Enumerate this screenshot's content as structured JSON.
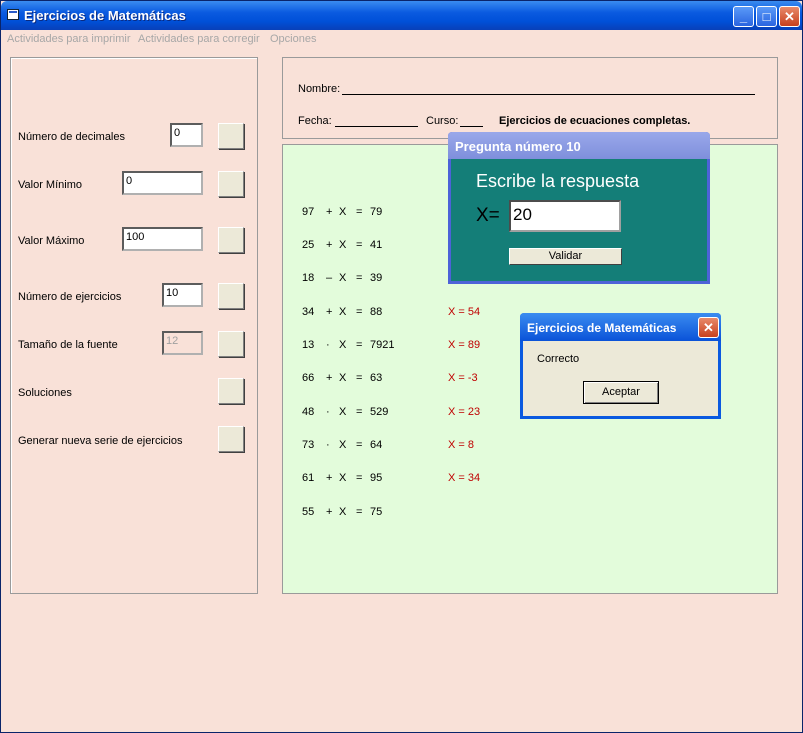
{
  "window": {
    "title": "Ejercicios de Matemáticas"
  },
  "menu": [
    "Actividades para imprimir",
    "Actividades para corregir",
    "Opciones"
  ],
  "settings": {
    "decimales": {
      "label": "Número de decimales",
      "value": "0"
    },
    "minimo": {
      "label": "Valor Mínimo",
      "value": "0"
    },
    "maximo": {
      "label": "Valor Máximo",
      "value": "100"
    },
    "ejercicios": {
      "label": "Número de ejercicios",
      "value": "10"
    },
    "fuente": {
      "label": "Tamaño de la fuente",
      "value": "12"
    },
    "soluciones": {
      "label": "Soluciones"
    },
    "generar": {
      "label": "Generar nueva serie de ejercicios"
    }
  },
  "header": {
    "nombre": "Nombre:",
    "fecha": "Fecha:",
    "curso": "Curso:",
    "title": "Ejercicios de ecuaciones completas."
  },
  "exercises": [
    {
      "a": "97",
      "op": "+",
      "x": "X",
      "eq": "=",
      "result": "79",
      "solution": ""
    },
    {
      "a": "25",
      "op": "+",
      "x": "X",
      "eq": "=",
      "result": "41",
      "solution": ""
    },
    {
      "a": "18",
      "op": "–",
      "x": "X",
      "eq": "=",
      "result": "39",
      "solution": ""
    },
    {
      "a": "34",
      "op": "+",
      "x": "X",
      "eq": "=",
      "result": "88",
      "solution": "X = 54"
    },
    {
      "a": "13",
      "op": "·",
      "x": "X",
      "eq": "=",
      "result": "7921",
      "solution": "X = 89"
    },
    {
      "a": "66",
      "op": "+",
      "x": "X",
      "eq": "=",
      "result": "63",
      "solution": "X = -3"
    },
    {
      "a": "48",
      "op": "·",
      "x": "X",
      "eq": "=",
      "result": "529",
      "solution": "X = 23"
    },
    {
      "a": "73",
      "op": "·",
      "x": "X",
      "eq": "=",
      "result": "64",
      "solution": "X = 8"
    },
    {
      "a": "61",
      "op": "+",
      "x": "X",
      "eq": "=",
      "result": "95",
      "solution": "X = 34"
    },
    {
      "a": "55",
      "op": "+",
      "x": "X",
      "eq": "=",
      "result": "75",
      "solution": ""
    }
  ],
  "question_dialog": {
    "title": "Pregunta número 10",
    "heading": "Escribe la respuesta",
    "x_label": "X=",
    "answer": "20",
    "button": "Validar"
  },
  "message_dialog": {
    "title": "Ejercicios de Matemáticas",
    "message": "Correcto",
    "button": "Aceptar"
  },
  "colors": {
    "background": "#f9e1d8",
    "exercise_bg": "#e3fcdb",
    "dialog_teal": "#147e78",
    "solution_red": "#c00000"
  }
}
